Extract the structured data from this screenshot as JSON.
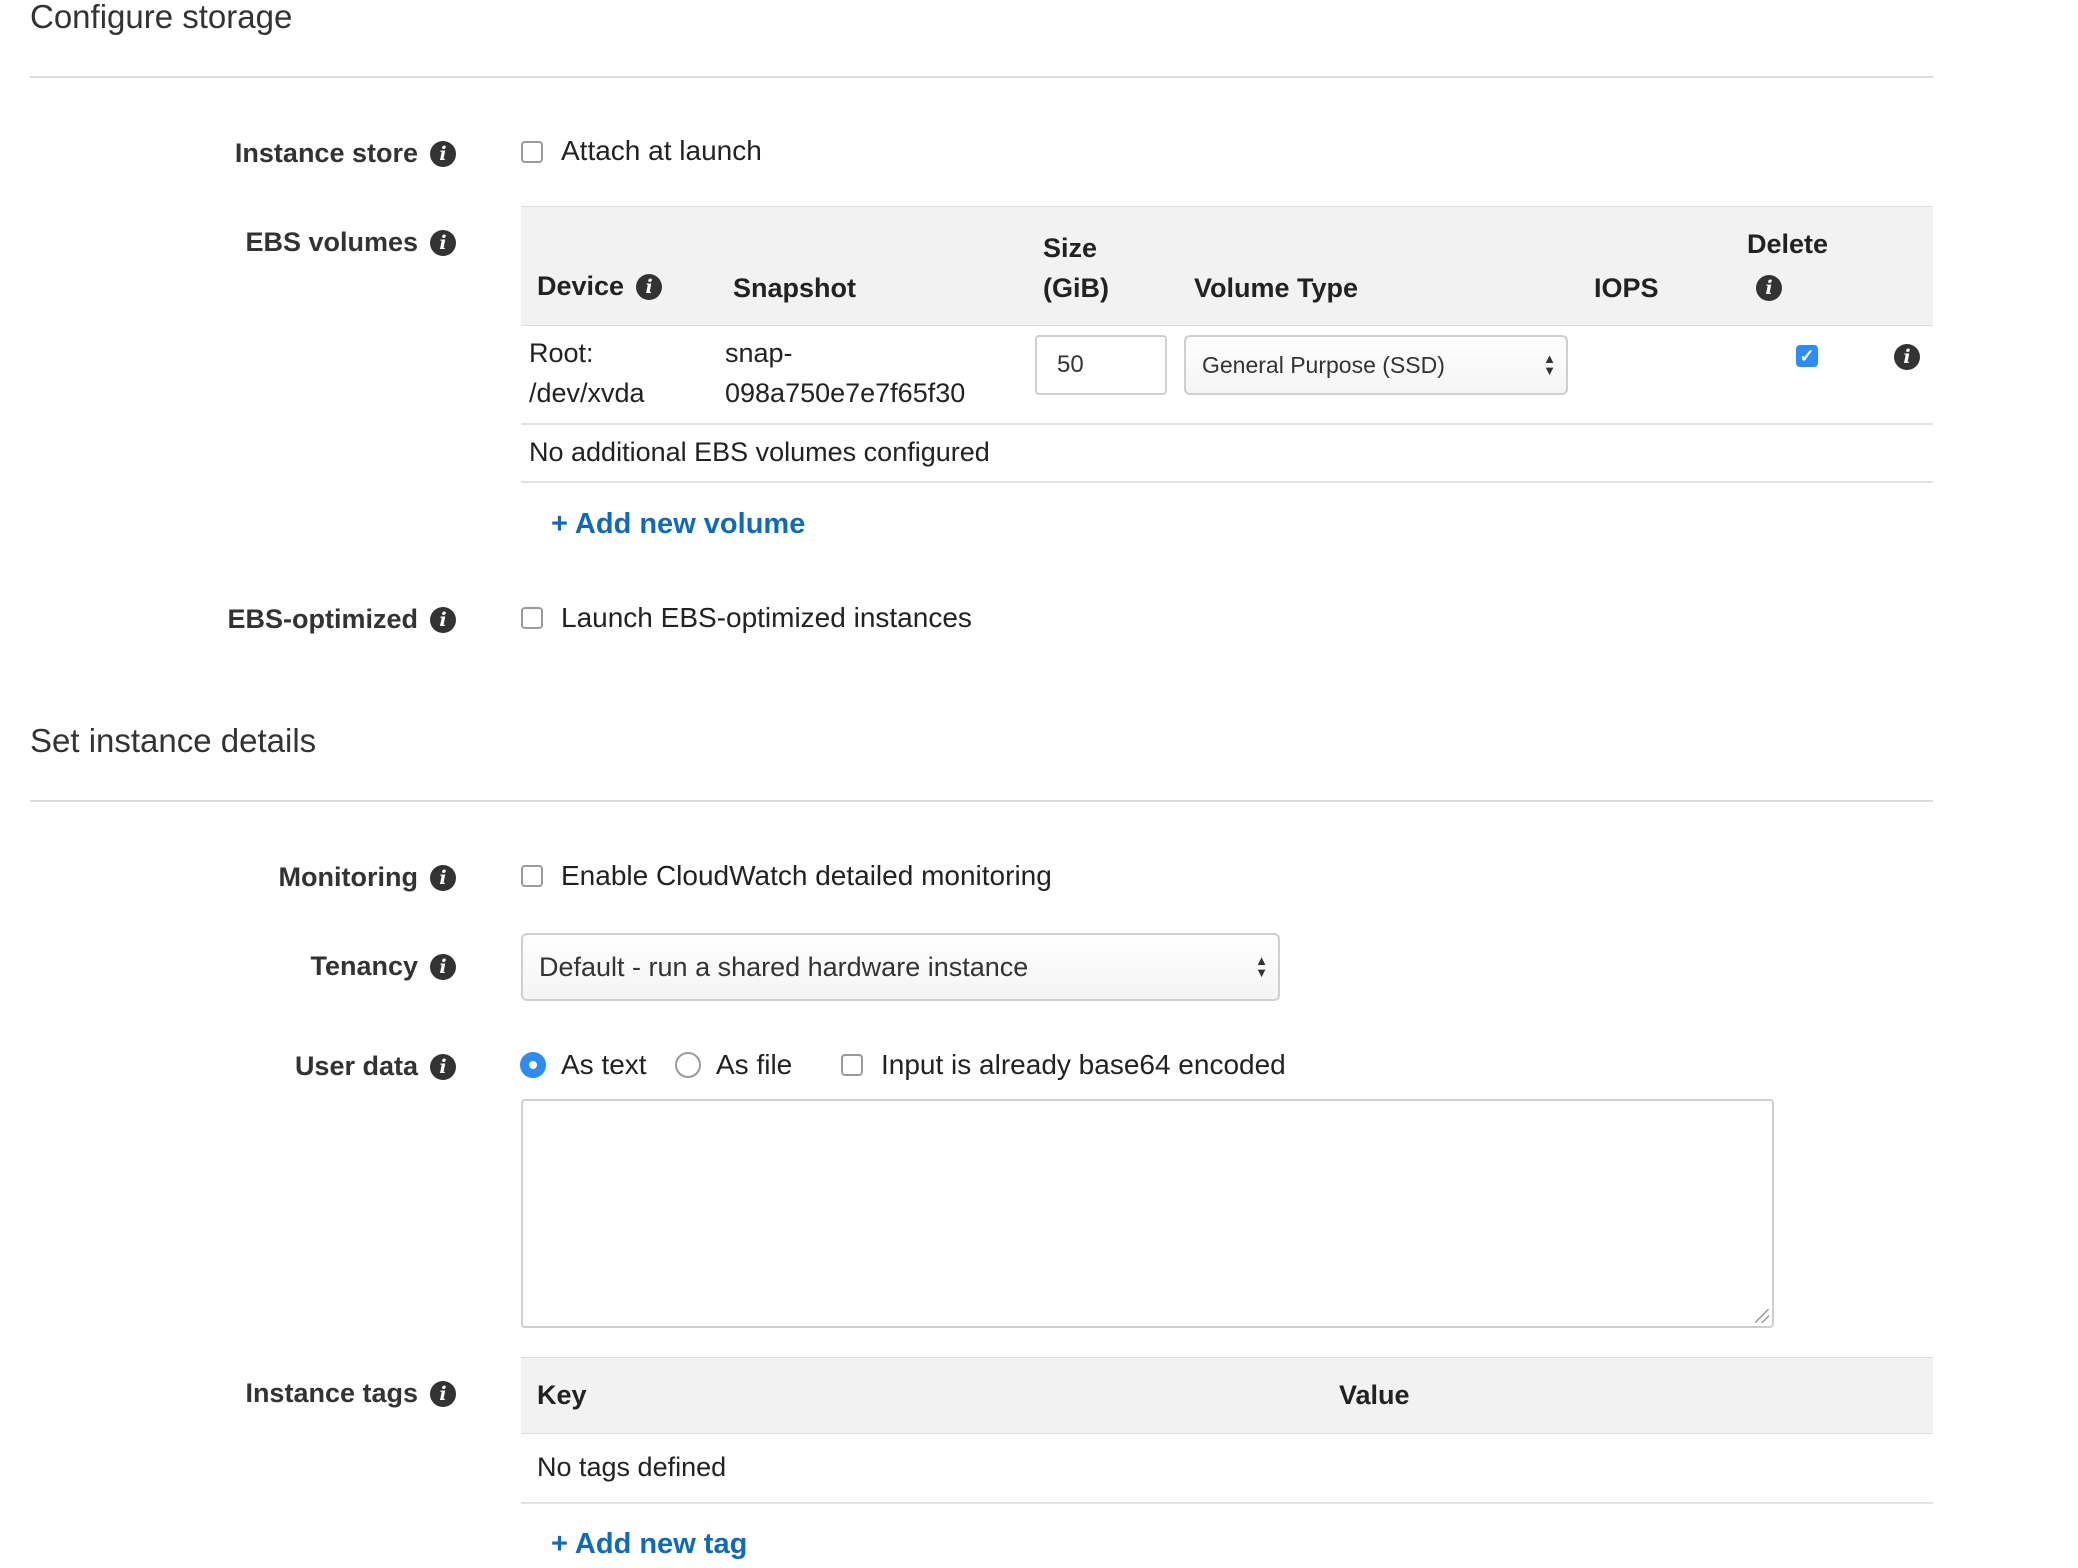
{
  "sections": {
    "storage_title": "Configure storage",
    "details_title": "Set instance details"
  },
  "instance_store": {
    "label": "Instance store",
    "checkbox_label": "Attach at launch",
    "checked": false
  },
  "ebs_volumes": {
    "label": "EBS volumes",
    "columns": {
      "device": "Device",
      "snapshot": "Snapshot",
      "size_line1": "Size",
      "size_line2": "(GiB)",
      "volume_type": "Volume Type",
      "iops": "IOPS",
      "delete": "Delete"
    },
    "root_row": {
      "device_line1": "Root:",
      "device_line2": "/dev/xvda",
      "snapshot_line1": "snap-",
      "snapshot_line2": "098a750e7e7f65f30",
      "size_value": "50",
      "volume_type_value": "General Purpose (SSD)",
      "delete_checked": true
    },
    "empty_message": "No additional EBS volumes configured",
    "add_link": "+ Add new volume"
  },
  "ebs_optimized": {
    "label": "EBS-optimized",
    "checkbox_label": "Launch EBS-optimized instances",
    "checked": false
  },
  "monitoring": {
    "label": "Monitoring",
    "checkbox_label": "Enable CloudWatch detailed monitoring",
    "checked": false
  },
  "tenancy": {
    "label": "Tenancy",
    "selected": "Default - run a shared hardware instance"
  },
  "user_data": {
    "label": "User data",
    "option_text": "As text",
    "option_file": "As file",
    "base64_label": "Input is already base64 encoded",
    "selected": "As text",
    "textarea_value": ""
  },
  "instance_tags": {
    "label": "Instance tags",
    "columns": {
      "key": "Key",
      "value": "Value"
    },
    "empty_message": "No tags defined",
    "add_link": "+ Add new tag"
  },
  "icons": {
    "info": "info-icon",
    "select_arrows": "select-arrows-icon",
    "checkmark": "checkmark-icon"
  },
  "colors": {
    "link": "#0f6ab7",
    "checkbox_checked": "#2f8bf4",
    "table_header_bg": "#f2f2f2"
  }
}
